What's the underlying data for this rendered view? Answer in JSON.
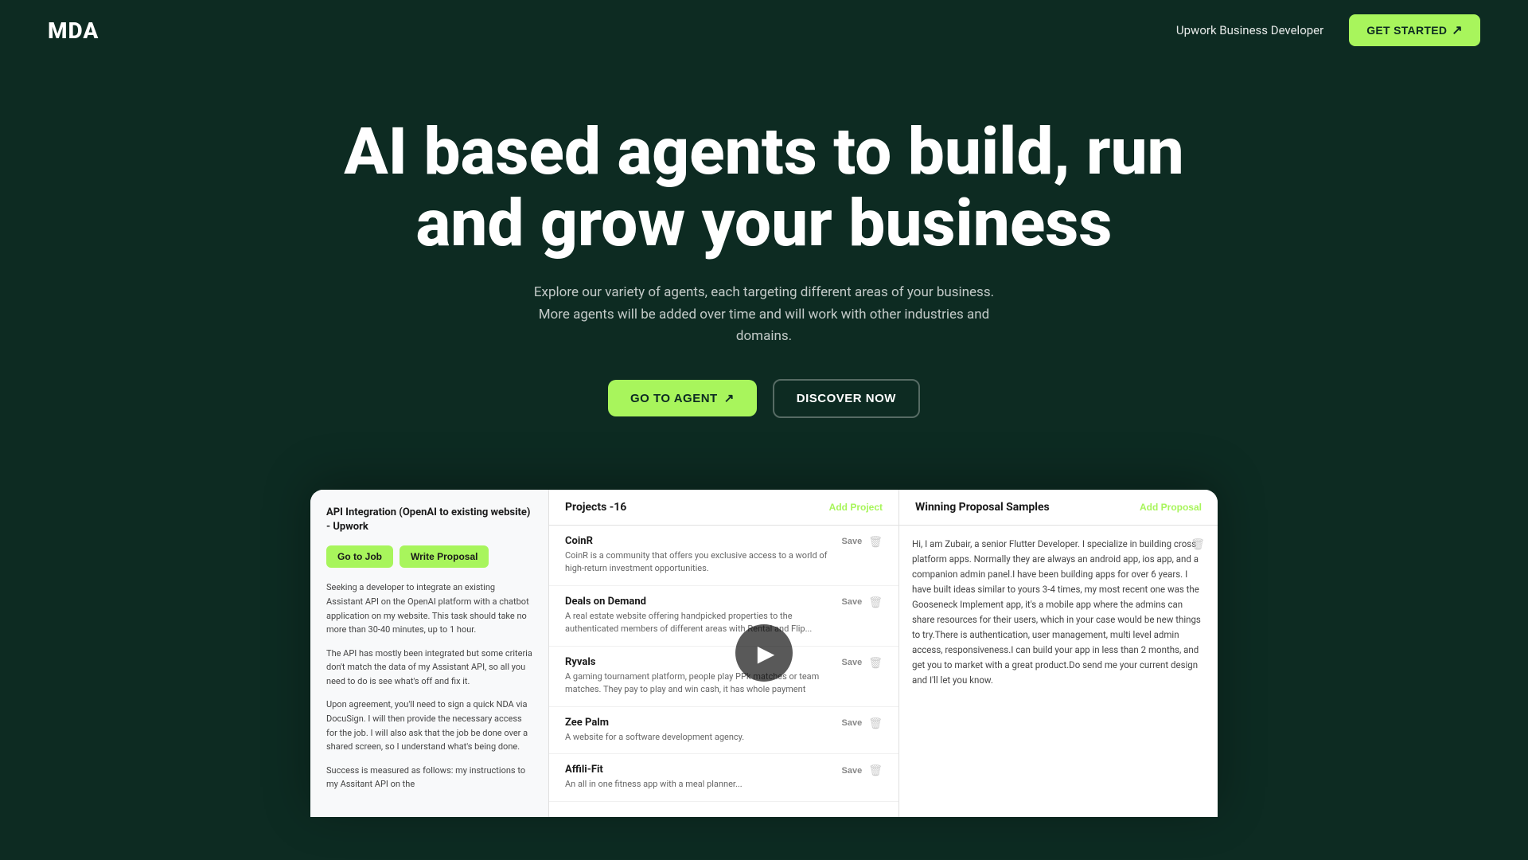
{
  "nav": {
    "logo": "MDA",
    "nav_link": "Upwork Business Developer",
    "get_started": "GET STARTED"
  },
  "hero": {
    "title": "AI based agents to build, run and grow your business",
    "subtitle": "Explore our variety of agents, each targeting different areas of your business. More agents will be added over time and will work with other industries and domains.",
    "btn_agent": "GO TO AGENT",
    "btn_discover": "DISCOVER NOW"
  },
  "left_panel": {
    "job_title": "API Integration (OpenAI to existing website) - Upwork",
    "btn_go_job": "Go to Job",
    "btn_write_proposal": "Write Proposal",
    "description_1": "Seeking a developer to integrate an existing Assistant API on the OpenAI platform with a chatbot application on my website. This task should take no more than 30-40 minutes, up to 1 hour.",
    "description_2": "The API has mostly been integrated but some criteria don't match the data of my Assistant API, so all you need to do is see what's off and fix it.",
    "description_3": "Upon agreement, you'll need to sign a quick NDA via DocuSign. I will then provide the necessary access for the job. I will also ask that the job be done over a shared screen, so I understand what's being done.",
    "description_4": "Success is measured as follows: my instructions to my Assitant API on the"
  },
  "middle_panel": {
    "title": "Projects -16",
    "add_label": "Add Project",
    "projects": [
      {
        "name": "CoinR",
        "desc": "CoinR is a community that offers you exclusive access to a world of high-return investment opportunities."
      },
      {
        "name": "Deals on Demand",
        "desc": "A real estate website offering handpicked properties to the authenticated members of different areas with Rental and Flip..."
      },
      {
        "name": "Ryvals",
        "desc": "A gaming tournament platform, people play PPk matches or team matches. They pay to play and win cash, it has whole payment"
      },
      {
        "name": "Zee Palm",
        "desc": "A website for a software development agency."
      },
      {
        "name": "Affili-Fit",
        "desc": "An all in one fitness app with a meal planner..."
      }
    ]
  },
  "right_panel": {
    "title": "Winning Proposal Samples",
    "add_label": "Add Proposal",
    "proposal_text": "Hi, I am Zubair, a senior Flutter Developer. I specialize in building cross platform apps. Normally they are always an android app, ios app, and a companion admin panel.I have been building apps for over 6 years. I have built ideas similar to yours 3-4 times, my most recent one was the Gooseneck Implement app, it's a mobile app where the admins can share resources for their users, which in your case would be new things to try.There is authentication, user management, multi level admin access, responsiveness.I can build your app in less than 2 months, and get you to market with a great product.Do send me your current design and I'll let you know."
  }
}
